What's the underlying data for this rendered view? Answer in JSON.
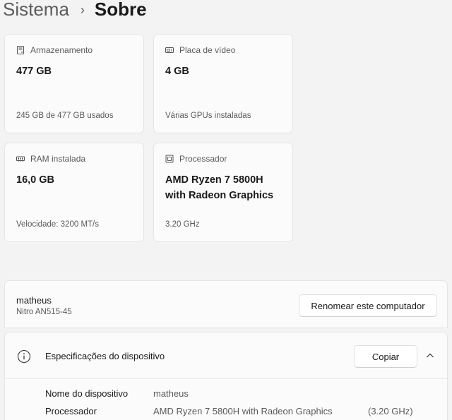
{
  "breadcrumb": {
    "parent": "Sistema",
    "separator": "›",
    "current": "Sobre"
  },
  "cards": {
    "storage": {
      "icon": "storage-icon",
      "label": "Armazenamento",
      "value": "477 GB",
      "sub": "245 GB de 477 GB usados"
    },
    "gpu": {
      "icon": "gpu-icon",
      "label": "Placa de vídeo",
      "value": "4 GB",
      "sub": "Várias GPUs instaladas"
    },
    "ram": {
      "icon": "ram-icon",
      "label": "RAM instalada",
      "value": "16,0 GB",
      "sub": "Velocidade: 3200 MT/s"
    },
    "cpu": {
      "icon": "processor-icon",
      "label": "Processador",
      "value_line1": "AMD Ryzen 7 5800H",
      "value_line2": "with Radeon Graphics",
      "sub": "3.20 GHz"
    }
  },
  "computer": {
    "name": "matheus",
    "model": "Nitro AN515-45",
    "rename_label": "Renomear este computador"
  },
  "specs": {
    "title": "Especificações do dispositivo",
    "copy_label": "Copiar",
    "rows": [
      {
        "label": "Nome do dispositivo",
        "value": "matheus",
        "extra": ""
      },
      {
        "label": "Processador",
        "value": "AMD Ryzen 7 5800H with Radeon Graphics",
        "extra": "(3.20 GHz)"
      }
    ]
  }
}
